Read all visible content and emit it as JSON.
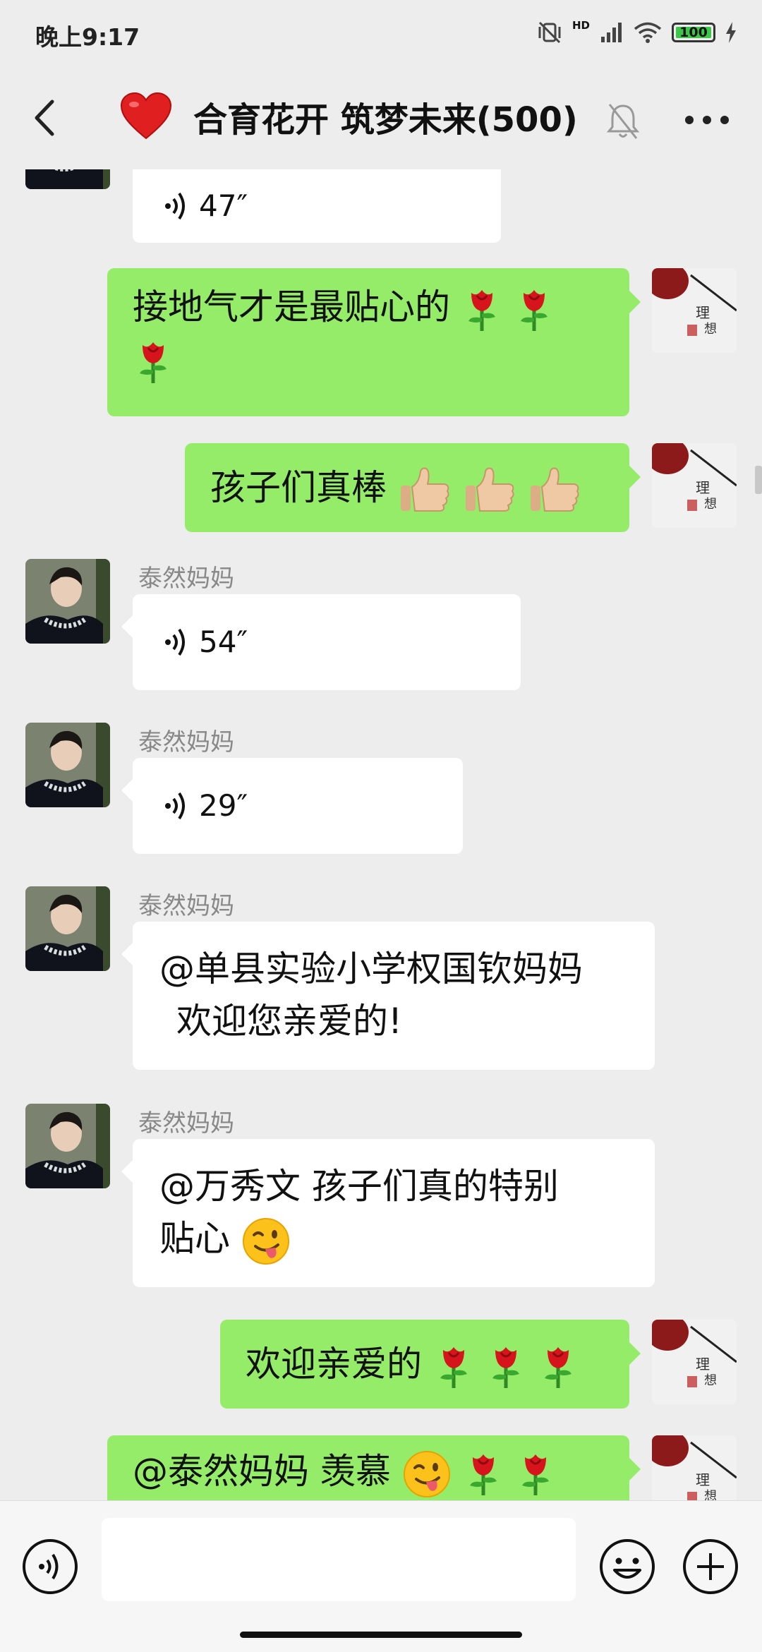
{
  "status": {
    "time": "晚上9:17",
    "network": "HD",
    "battery": "100",
    "battery_level": 1.0
  },
  "header": {
    "title": "合育花开 筑梦未来(500)",
    "heart_icon": "red-heart-icon",
    "mute_icon": "bell-muted-icon",
    "more_icon": "more-dots-icon"
  },
  "messages": [
    {
      "side": "left",
      "type": "voice",
      "duration": "47″"
    },
    {
      "side": "right",
      "type": "text",
      "line1": "接地气才是最贴心的",
      "emojis": [
        "rose",
        "rose",
        "rose"
      ]
    },
    {
      "side": "right",
      "type": "text",
      "text": "孩子们真棒",
      "emojis": [
        "thumbs-up",
        "thumbs-up",
        "thumbs-up"
      ]
    },
    {
      "side": "left",
      "sender": "泰然妈妈",
      "type": "voice",
      "duration": "54″"
    },
    {
      "side": "left",
      "sender": "泰然妈妈",
      "type": "voice",
      "duration": "29″"
    },
    {
      "side": "left",
      "sender": "泰然妈妈",
      "type": "text",
      "line1": "@单县实验小学权国钦妈妈",
      "line2": "欢迎您亲爱的!"
    },
    {
      "side": "left",
      "sender": "泰然妈妈",
      "type": "text",
      "line1": "@万秀文  孩子们真的特别",
      "line2": "贴心",
      "emojis": [
        "winking-tongue"
      ]
    },
    {
      "side": "right",
      "type": "text",
      "text": "欢迎亲爱的",
      "emojis": [
        "rose",
        "rose",
        "rose"
      ]
    },
    {
      "side": "right",
      "type": "text",
      "text": "@泰然妈妈  羡慕",
      "emojis": [
        "winking-tongue",
        "rose",
        "rose"
      ]
    }
  ],
  "input": {
    "placeholder": "",
    "voice_icon": "voice-mode-icon",
    "emoji_icon": "emoji-icon",
    "plus_icon": "plus-icon"
  },
  "colors": {
    "background": "#ededed",
    "my_bubble": "#95ec69",
    "their_bubble": "#ffffff",
    "accent_heart": "#e02020"
  }
}
